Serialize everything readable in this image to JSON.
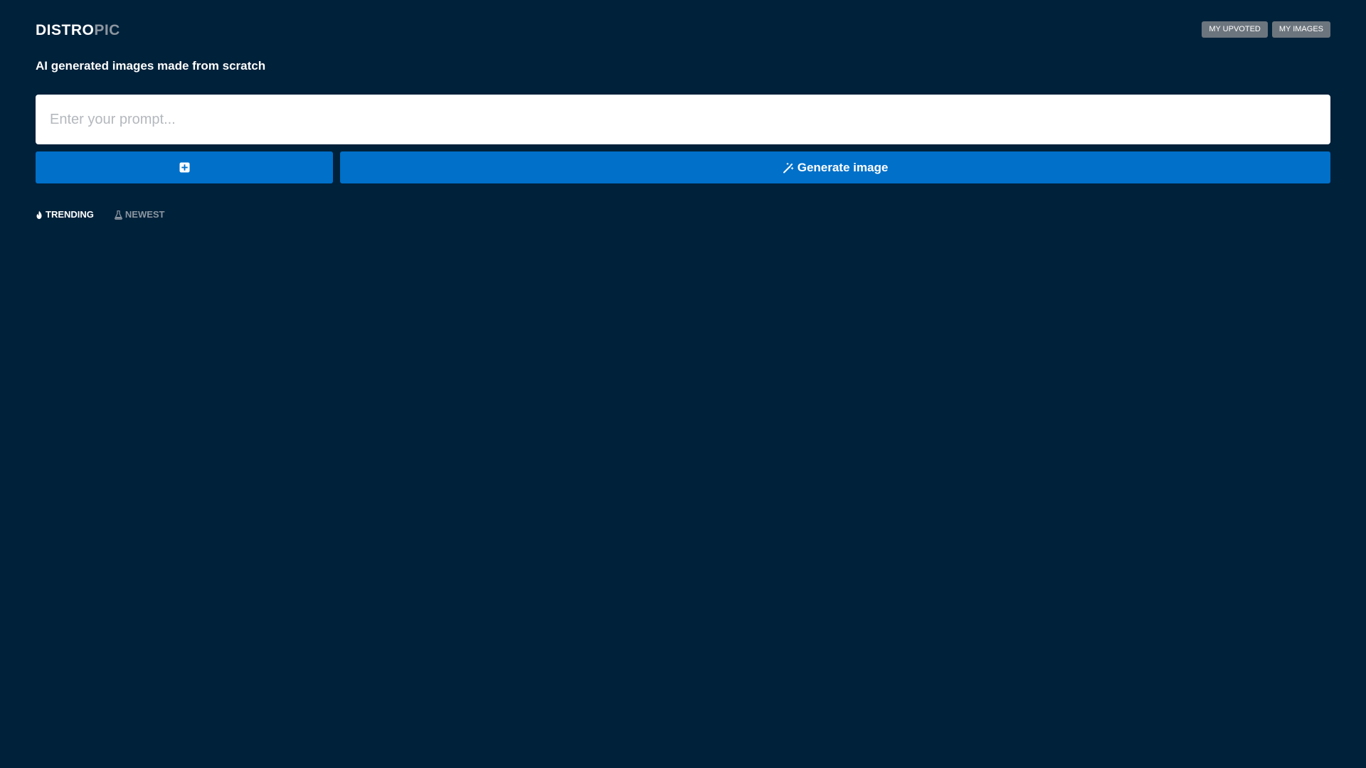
{
  "header": {
    "logo_primary": "DISTRO",
    "logo_secondary": "PIC",
    "buttons": [
      {
        "label": "MY UPVOTED"
      },
      {
        "label": "MY IMAGES"
      }
    ]
  },
  "tagline": "AI generated images made from scratch",
  "prompt": {
    "placeholder": "Enter your prompt...",
    "value": ""
  },
  "actions": {
    "add_icon": "plus-square-icon",
    "generate_icon": "magic-wand-icon",
    "generate_label": "Generate image"
  },
  "tabs": [
    {
      "label": "TRENDING",
      "icon": "fire-icon",
      "active": true
    },
    {
      "label": "NEWEST",
      "icon": "flask-icon",
      "active": false
    }
  ],
  "colors": {
    "background": "#00213a",
    "primary": "#0070c9",
    "secondary_button": "#6c757d",
    "logo_secondary": "#8d96a0",
    "inactive_tab": "#8c96a1"
  }
}
